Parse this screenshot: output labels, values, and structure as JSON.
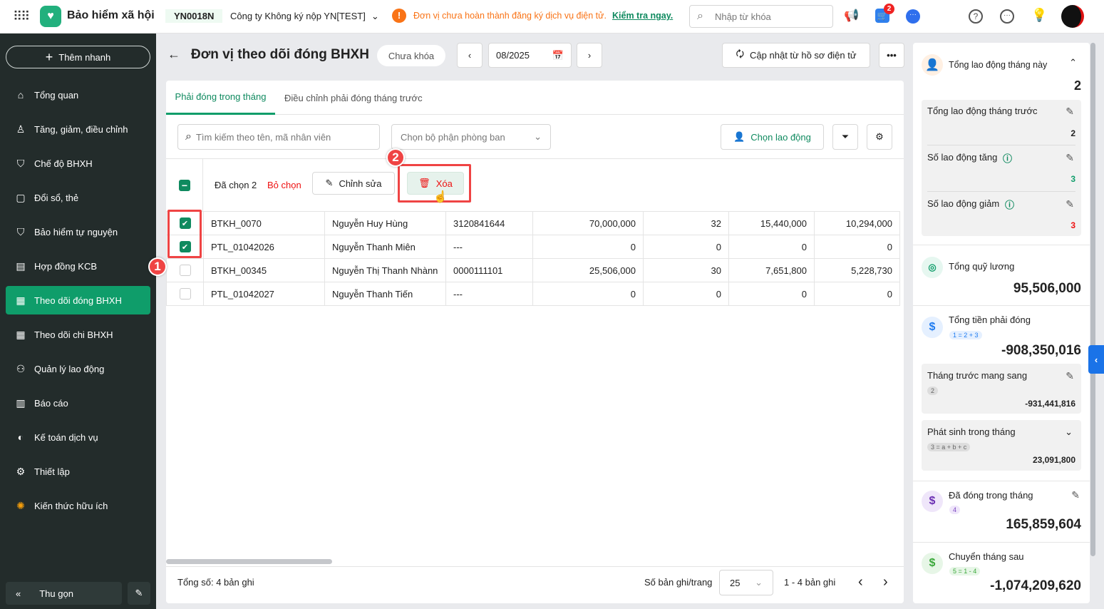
{
  "app": {
    "title": "Bảo hiểm xã hội",
    "unit_code": "YN0018N",
    "company": "Công ty Không ký nộp YN[TEST]",
    "warning": "Đơn vị chưa hoàn thành đăng ký dịch vụ điện tử.",
    "warning_link": "Kiểm tra ngay.",
    "search_placeholder": "Nhập từ khóa",
    "cart_badge": "2"
  },
  "sidebar": {
    "quick_add": "Thêm nhanh",
    "items": [
      {
        "label": "Tổng quan",
        "icon": "home-icon"
      },
      {
        "label": "Tăng, giảm, điều chỉnh",
        "icon": "user-icon"
      },
      {
        "label": "Chế độ BHXH",
        "icon": "shield-icon"
      },
      {
        "label": "Đổi sổ, thẻ",
        "icon": "card-icon"
      },
      {
        "label": "Bảo hiểm tự nguyện",
        "icon": "shield-heart-icon"
      },
      {
        "label": "Hợp đồng KCB",
        "icon": "contract-icon"
      },
      {
        "label": "Theo dõi đóng BHXH",
        "icon": "doc-icon"
      },
      {
        "label": "Theo dõi chi BHXH",
        "icon": "doc-icon"
      },
      {
        "label": "Quản lý lao động",
        "icon": "users-icon"
      },
      {
        "label": "Báo cáo",
        "icon": "report-icon"
      },
      {
        "label": "Kế toán dịch vụ",
        "icon": "accounting-icon"
      },
      {
        "label": "Thiết lập",
        "icon": "gear-icon"
      },
      {
        "label": "Kiến thức hữu ích",
        "icon": "bulb-icon"
      }
    ],
    "collapse": "Thu gọn"
  },
  "page": {
    "title": "Đơn vị theo dõi đóng BHXH",
    "status": "Chưa khóa",
    "period": "08/2025",
    "update_btn": "Cập nhật từ hồ sơ điện tử"
  },
  "tabs": [
    "Phải đóng trong tháng",
    "Điều chỉnh phải đóng tháng trước"
  ],
  "filters": {
    "search_placeholder": "Tìm kiếm theo tên, mã nhân viên",
    "dept_placeholder": "Chọn bộ phận phòng ban",
    "choose_employee": "Chọn lao động"
  },
  "selection": {
    "selected": "Đã chọn 2",
    "deselect": "Bỏ chọn",
    "edit": "Chỉnh sửa",
    "delete": "Xóa"
  },
  "rows": [
    {
      "checked": true,
      "code": "BTKH_0070",
      "name": "Nguyễn Huy Hùng",
      "id": "3120841644",
      "c1": "70,000,000",
      "c2": "32",
      "c3": "15,440,000",
      "c4": "10,294,000"
    },
    {
      "checked": true,
      "code": "PTL_01042026",
      "name": "Nguyễn Thanh Miên",
      "id": "---",
      "c1": "0",
      "c2": "0",
      "c3": "0",
      "c4": "0"
    },
    {
      "checked": false,
      "code": "BTKH_00345",
      "name": "Nguyễn Thị Thanh Nhànn",
      "id": "0000111101",
      "c1": "25,506,000",
      "c2": "30",
      "c3": "7,651,800",
      "c4": "5,228,730"
    },
    {
      "checked": false,
      "code": "PTL_01042027",
      "name": "Nguyễn Thanh Tiến",
      "id": "---",
      "c1": "0",
      "c2": "0",
      "c3": "0",
      "c4": "0"
    }
  ],
  "footer": {
    "total": "Tổng số: 4 bản ghi",
    "per_page_label": "Số bản ghi/trang",
    "per_page": "25",
    "range": "1 - 4 bản ghi"
  },
  "annotations": {
    "step1": "1",
    "step2": "2"
  },
  "summary": {
    "labor_this_month": {
      "label": "Tổng lao động tháng này",
      "value": "2"
    },
    "labor_prev": {
      "label": "Tổng lao động tháng trước",
      "value": "2"
    },
    "labor_inc": {
      "label": "Số lao động tăng",
      "value": "3"
    },
    "labor_dec": {
      "label": "Số lao động giảm",
      "value": "3"
    },
    "salary_fund": {
      "label": "Tổng quỹ lương",
      "value": "95,506,000"
    },
    "total_due": {
      "label": "Tổng tiền phải đóng",
      "formula": "1 = 2 + 3",
      "value": "-908,350,016"
    },
    "carried": {
      "label": "Tháng trước mang sang",
      "formula": "2",
      "value": "-931,441,816"
    },
    "arising": {
      "label": "Phát sinh trong tháng",
      "formula": "3 = a + b + c",
      "value": "23,091,800"
    },
    "paid": {
      "label": "Đã đóng trong tháng",
      "formula": "4",
      "value": "165,859,604"
    },
    "next": {
      "label": "Chuyển tháng sau",
      "formula": "5 = 1 - 4",
      "value": "-1,074,209,620"
    }
  }
}
